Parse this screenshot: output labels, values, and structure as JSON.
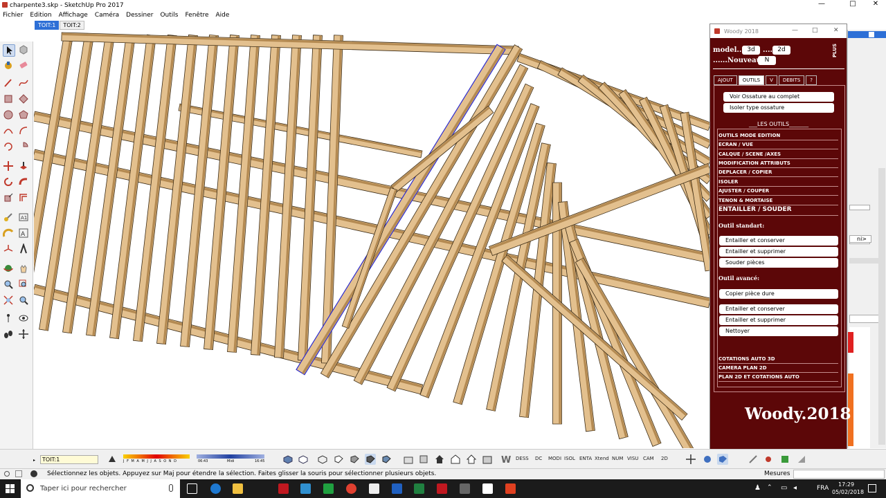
{
  "window": {
    "title": "charpente3.skp - SketchUp Pro 2017",
    "controls": [
      "—",
      "□",
      "✕"
    ]
  },
  "menu": [
    "Fichier",
    "Edition",
    "Affichage",
    "Caméra",
    "Dessiner",
    "Outils",
    "Fenêtre",
    "Aide"
  ],
  "scene_tabs": [
    "TOIT:1",
    "TOIT:2"
  ],
  "woody": {
    "window_title": "Woody 2018",
    "model_label": "model....",
    "btn_3d": "3d",
    "sep": "....",
    "btn_2d": "2d",
    "nouveau_label": "......Nouveau ..",
    "btn_n": "N",
    "tabs": [
      "AJOUT",
      "OUTILS",
      "V",
      "DEBITS",
      "?"
    ],
    "btn_voir": "Voir Ossature au complet",
    "btn_isoler": "Isoler type ossature",
    "les_outils": "___LES OUTILS_______",
    "sections": [
      "OUTILS MODE EDITION",
      "ECRAN / VUE",
      "CALQUE / SCENE /AXES",
      "MODIFICATION ATTRIBUTS",
      "DEPLACER / COPIER",
      "ISOLER",
      "AJUSTER / COUPER",
      "TENON & MORTAISE"
    ],
    "section_active": "ENTAILLER / SOUDER",
    "outil_standart": "Outil standart:",
    "standart_items": [
      "Entailler et conserver",
      "Entailler et supprimer",
      "Souder pièces"
    ],
    "outil_avance": "Outil avancé:",
    "copier": "Copier pièce dure",
    "avance_items": [
      "Entailler et conserver",
      "Entailler et supprimer",
      "Nettoyer"
    ],
    "bottom_sections": [
      "COTATIONS AUTO 3D",
      "CAMERA PLAN 2D",
      "PLAN 2D ET COTATIONS AUTO"
    ],
    "logo": "Woody.2018",
    "side_badge": "PLUS"
  },
  "bottombar": {
    "scene": "TOIT:1",
    "months": "J F M A M J J A S O N D",
    "time_start": "06:43",
    "time_mid": "Midi",
    "time_end": "16:45",
    "text_buttons": [
      "DESS",
      "DC",
      "MODI",
      "ISOL",
      "ENTA",
      "Xtend",
      "NUM",
      "VISU",
      "CAM",
      "2D"
    ]
  },
  "status": {
    "message": "Sélectionnez les objets. Appuyez sur Maj pour étendre la sélection. Faites glisser la souris pour sélectionner plusieurs objets.",
    "measures_label": "Mesures"
  },
  "tray": {
    "field_text": "ni>"
  },
  "taskbar": {
    "search_placeholder": "Taper ici pour rechercher",
    "lang": "FRA",
    "time": "17:29",
    "date": "05/02/2018"
  },
  "colors": {
    "woody_bg": "#5c0708",
    "scene_tab_active": "#2d6fd6",
    "wood": "#e3c08e",
    "wood_dark": "#b48a52",
    "selection": "#2a2ad0"
  }
}
